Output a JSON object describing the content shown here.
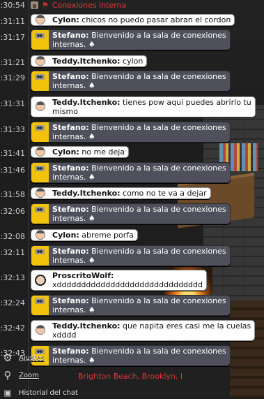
{
  "header": {
    "room_name": "Conexiones interna"
  },
  "messages": [
    {
      "time": ":30:54",
      "user": "",
      "text": "",
      "type": "header"
    },
    {
      "time": ":31:11",
      "user": "Cylon:",
      "text": " chicos no puedo pasar abran el cordon",
      "type": "user",
      "avatar": "face"
    },
    {
      "time": ":31:17",
      "user": "Stefano:",
      "text": " Bienvenido a la sala de conexiones",
      "line2": "internas. ♠",
      "type": "bot"
    },
    {
      "time": ":31:21",
      "user": "Teddy.Itchenko:",
      "text": " cylon",
      "type": "user",
      "avatar": "face"
    },
    {
      "time": ":31:29",
      "user": "Stefano:",
      "text": " Bienvenido a la sala de conexiones",
      "line2": "internas. ♠",
      "type": "bot"
    },
    {
      "time": ":31:31",
      "user": "Teddy.Itchenko:",
      "text": " tienes pow aqui puedes abrirlo tu",
      "line2": "mismo",
      "type": "user",
      "avatar": "face"
    },
    {
      "time": ":31:33",
      "user": "Stefano:",
      "text": " Bienvenido a la sala de conexiones",
      "line2": "internas. ♠",
      "type": "bot"
    },
    {
      "time": ":31:41",
      "user": "Cylon:",
      "text": " no me deja",
      "type": "user",
      "avatar": "face"
    },
    {
      "time": ":31:46",
      "user": "Stefano:",
      "text": " Bienvenido a la sala de conexiones",
      "line2": "internas. ♠",
      "type": "bot"
    },
    {
      "time": ":31:58",
      "user": "Teddy.Itchenko:",
      "text": " como no te va a dejar",
      "type": "user",
      "avatar": "face"
    },
    {
      "time": ":32:06",
      "user": "Stefano:",
      "text": " Bienvenido a la sala de conexiones",
      "line2": "internas. ♠",
      "type": "bot"
    },
    {
      "time": ":32:08",
      "user": "Cylon:",
      "text": " abreme porfa",
      "type": "user",
      "avatar": "face"
    },
    {
      "time": ":32:11",
      "user": "Stefano:",
      "text": " Bienvenido a la sala de conexiones",
      "line2": "internas. ♠",
      "type": "bot"
    },
    {
      "time": ":32:13",
      "user": "ProscritoWolf:",
      "text": "",
      "line2": "xdddddddddddddddddddddddddddddd",
      "type": "user",
      "avatar": "wolf"
    },
    {
      "time": ":32:24",
      "user": "Stefano:",
      "text": " Bienvenido a la sala de conexiones",
      "line2": "internas. ♠",
      "type": "bot"
    },
    {
      "time": ":32:42",
      "user": "Teddy.Itchenko:",
      "text": " que napita eres casi me la cuelas",
      "line2": "xdddd",
      "type": "user",
      "avatar": "face"
    },
    {
      "time": ":32:43",
      "user": "Stefano:",
      "text": " Bienvenido a la sala de conexiones",
      "line2": "internas. ♠",
      "type": "bot"
    }
  ],
  "controls": {
    "settings_label": "Ajustes",
    "zoom_label": "Zoom",
    "history_label": "Historial del chat"
  },
  "location": "Brighton Beach, Brooklyn, I",
  "colors": {
    "room_name": "#e03a3a",
    "bot_bubble": "#50505c",
    "bot_avatar": "#f2c20c",
    "user_bubble": "#ffffff"
  }
}
